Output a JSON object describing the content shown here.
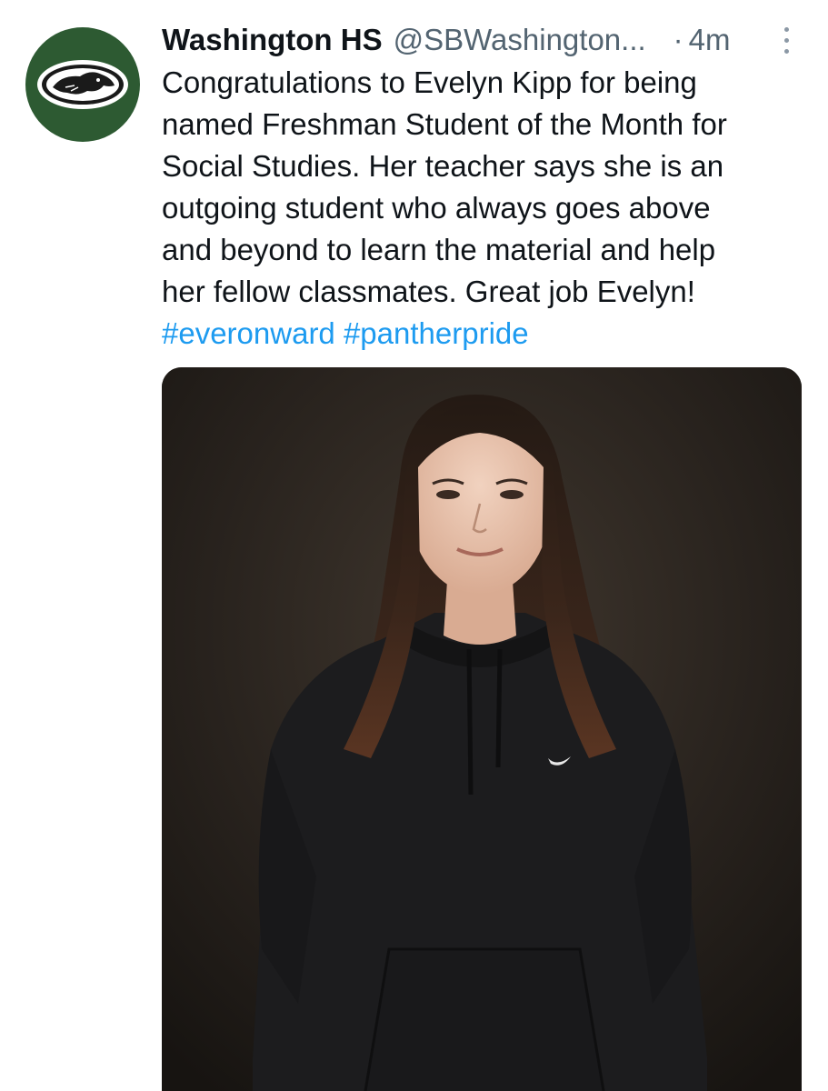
{
  "tweet": {
    "display_name": "Washington HS",
    "handle": "@SBWashington...",
    "separator": "·",
    "time": "4m",
    "text_lines": [
      "Congratulations to Evelyn Kipp for being",
      "named Freshman Student of the Month for",
      "Social Studies. Her teacher says she is an",
      "outgoing student who always goes above",
      "and beyond to learn the material and help",
      "her fellow classmates. Great job Evelyn!"
    ],
    "hashtags": [
      "#everonward",
      "#pantherpride"
    ],
    "avatar_icon": "panther-logo-icon",
    "more_icon": "more-vertical-icon"
  },
  "colors": {
    "avatar_bg": "#2d5a32",
    "hashtag": "#1d9bf0",
    "secondary_text": "#536471",
    "primary_text": "#0f1419"
  }
}
